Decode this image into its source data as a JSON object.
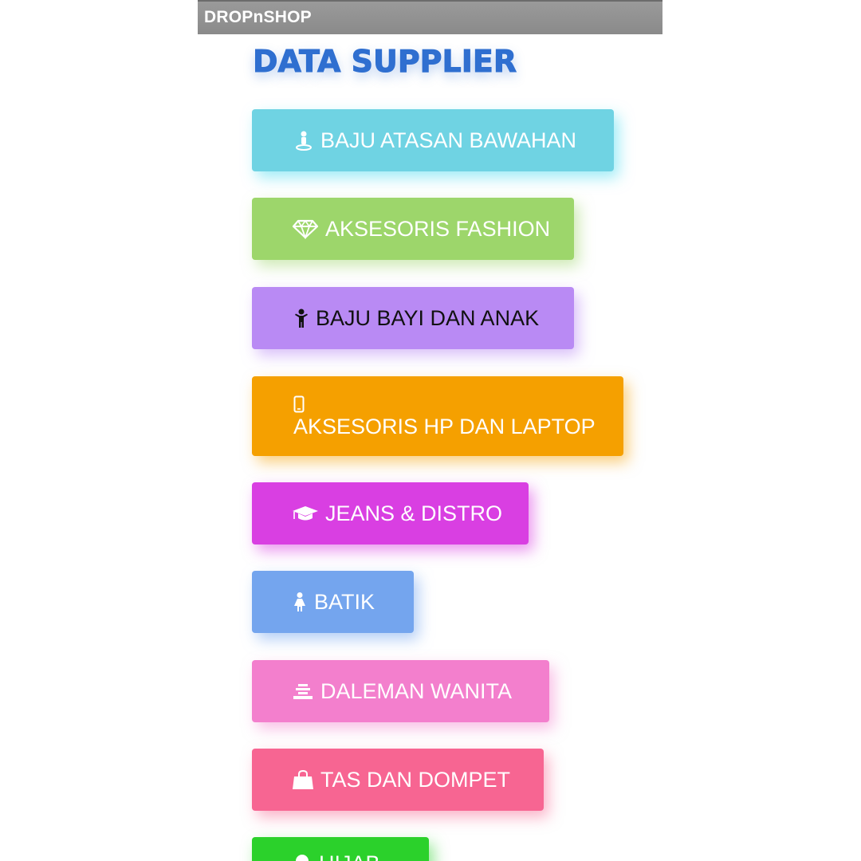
{
  "app_bar": {
    "title": "DROPnSHOP"
  },
  "page_title": "DATA SUPPLIER",
  "categories": [
    {
      "label": "BAJU ATASAN BAWAHAN",
      "icon": "person-pin-icon",
      "color": "#6fd3e3"
    },
    {
      "label": "AKSESORIS FASHION",
      "icon": "diamond-icon",
      "color": "#9dd66b"
    },
    {
      "label": "BAJU BAYI DAN ANAK",
      "icon": "child-icon",
      "color": "#b98af4"
    },
    {
      "label": "AKSESORIS HP DAN LAPTOP",
      "icon": "mobile-phone-icon",
      "color": "#f5a000"
    },
    {
      "label": "JEANS & DISTRO",
      "icon": "graduation-cap-icon",
      "color": "#d93fe2"
    },
    {
      "label": "BATIK",
      "icon": "woman-icon",
      "color": "#74a5ee"
    },
    {
      "label": "DALEMAN WANITA",
      "icon": "stack-icon",
      "color": "#f37fcd"
    },
    {
      "label": "TAS DAN DOMPET",
      "icon": "shopping-bag-icon",
      "color": "#f76592"
    },
    {
      "label": "HIJAB",
      "icon": "hijab-icon",
      "color": "#2bd12b"
    }
  ]
}
